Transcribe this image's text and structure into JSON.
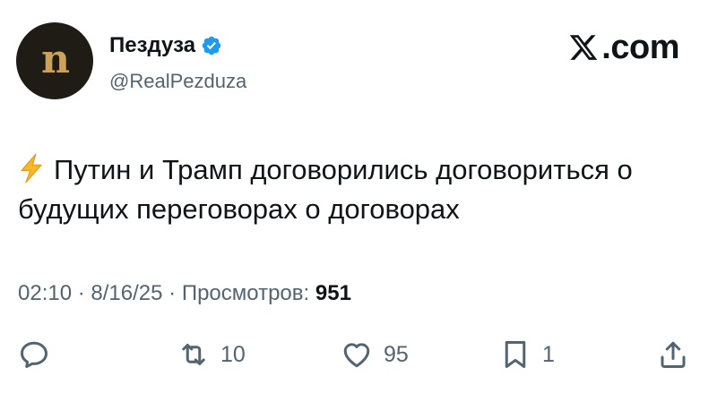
{
  "account": {
    "avatar_glyph": "n",
    "display_name": "Пездуза",
    "handle": "@RealPezduza",
    "verified": true
  },
  "brand": {
    "text": ".com"
  },
  "tweet": {
    "emoji": "⚡",
    "text": "Путин и Трамп договорились договориться о будущих переговорах о договорах"
  },
  "meta": {
    "time": "02:10",
    "date": "8/16/25",
    "views_label": "Просмотров:",
    "views_count": "951"
  },
  "actions": {
    "replies": "",
    "retweets": "10",
    "likes": "95",
    "bookmarks": "1"
  },
  "colors": {
    "verified": "#1d9bf0",
    "muted": "#536471",
    "text": "#0f1419",
    "bolt": "#f5b72c"
  }
}
